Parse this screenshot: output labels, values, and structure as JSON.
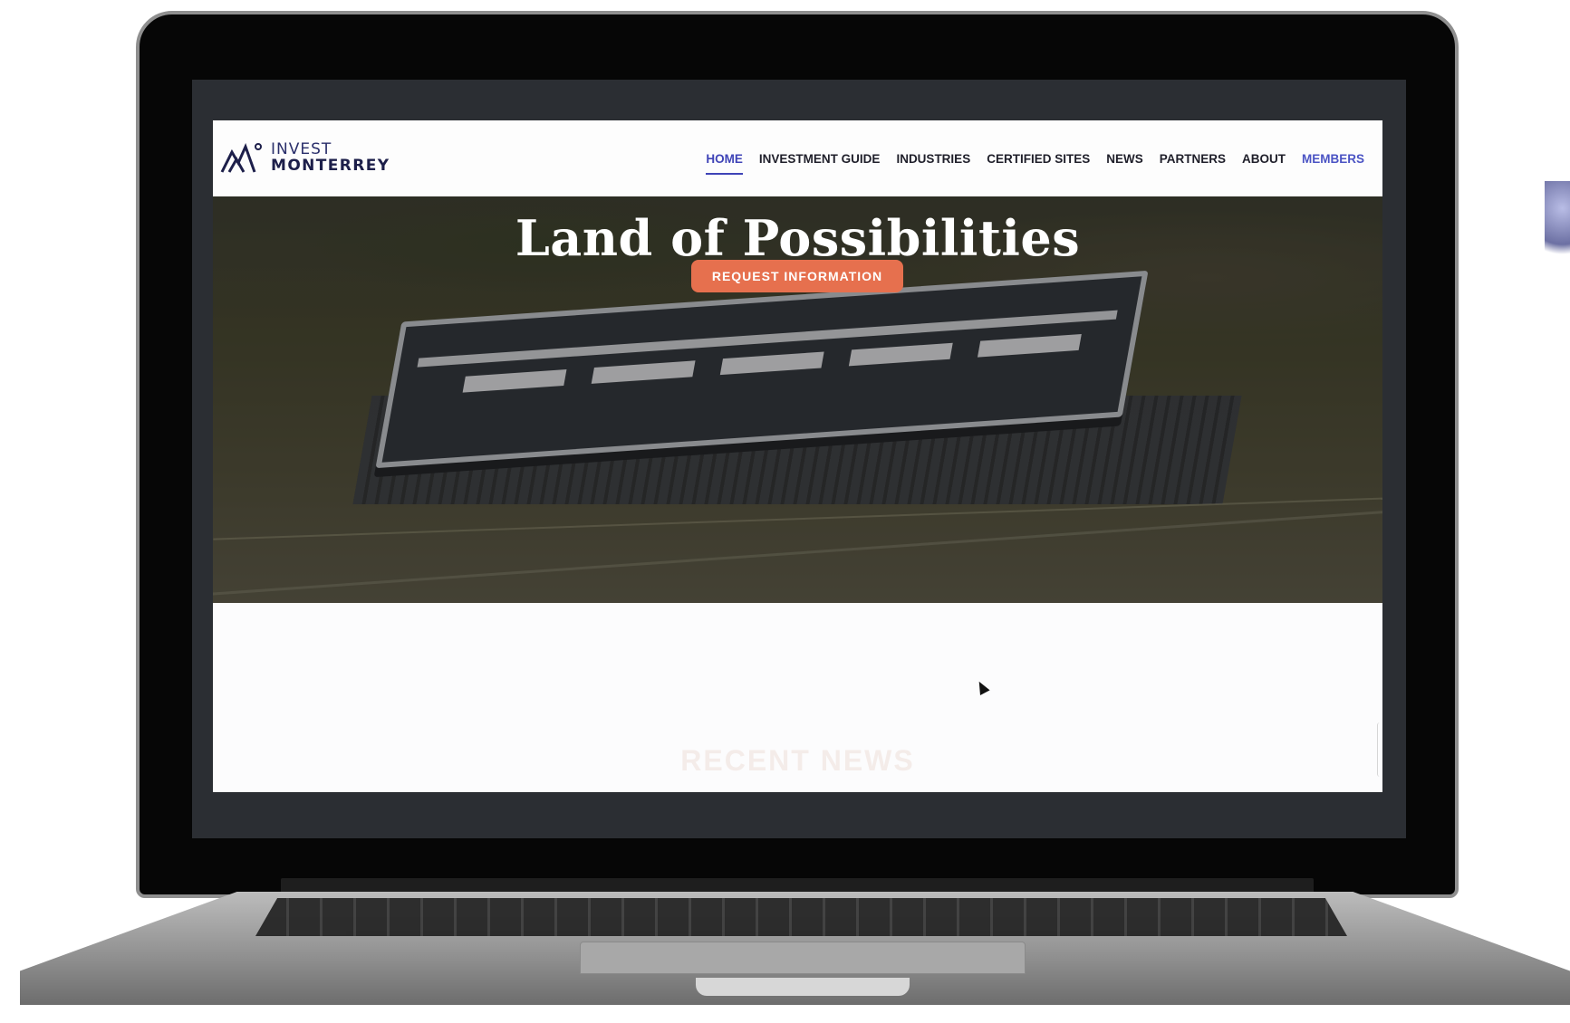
{
  "site": {
    "logo": {
      "line1": "INVEST",
      "line2": "MONTERREY"
    },
    "nav": [
      {
        "label": "HOME",
        "active": true
      },
      {
        "label": "INVESTMENT GUIDE"
      },
      {
        "label": "INDUSTRIES"
      },
      {
        "label": "CERTIFIED SITES"
      },
      {
        "label": "NEWS"
      },
      {
        "label": "PARTNERS"
      },
      {
        "label": "ABOUT"
      },
      {
        "label": "MEMBERS"
      }
    ]
  },
  "hero": {
    "title": "Land of Possibilities",
    "cta_label": "REQUEST INFORMATION"
  },
  "sections": {
    "recent_news_heading": "RECENT NEWS"
  },
  "colors": {
    "accent": "#e6704e",
    "nav_active": "#3f44b7",
    "brand_navy": "#1d1f4a"
  }
}
